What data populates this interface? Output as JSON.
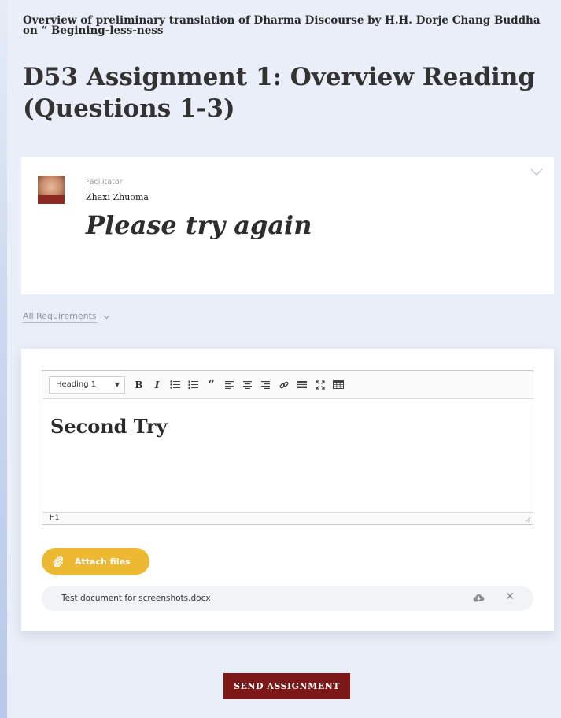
{
  "course": {
    "title": "Overview of preliminary translation of Dharma Discourse by H.H. Dorje Chang Buddha on “ Begining-less-ness"
  },
  "page": {
    "title": "D53 Assignment 1: Overview Reading (Questions 1-3)"
  },
  "feedback": {
    "role": "Facilitator",
    "name": "Zhaxi Zhuoma",
    "message": "Please try again"
  },
  "requirements": {
    "label": "All Requirements"
  },
  "editor": {
    "block_format": "Heading 1",
    "content": "Second Try",
    "status_path": "H1",
    "toolbar_icons": [
      "bold-icon",
      "italic-icon",
      "bullet-list-icon",
      "numbered-list-icon",
      "quote-icon",
      "align-left-icon",
      "align-center-icon",
      "align-right-icon",
      "link-icon",
      "horizontal-rule-icon",
      "fullscreen-icon",
      "table-icon"
    ]
  },
  "attachments": {
    "button_label": "Attach files",
    "files": [
      {
        "name": "Test document for screenshots.docx"
      }
    ]
  },
  "actions": {
    "send_label": "SEND ASSIGNMENT"
  },
  "colors": {
    "background": "#e9eef8",
    "attach_button": "#edb932",
    "send_button": "#7d1818"
  }
}
